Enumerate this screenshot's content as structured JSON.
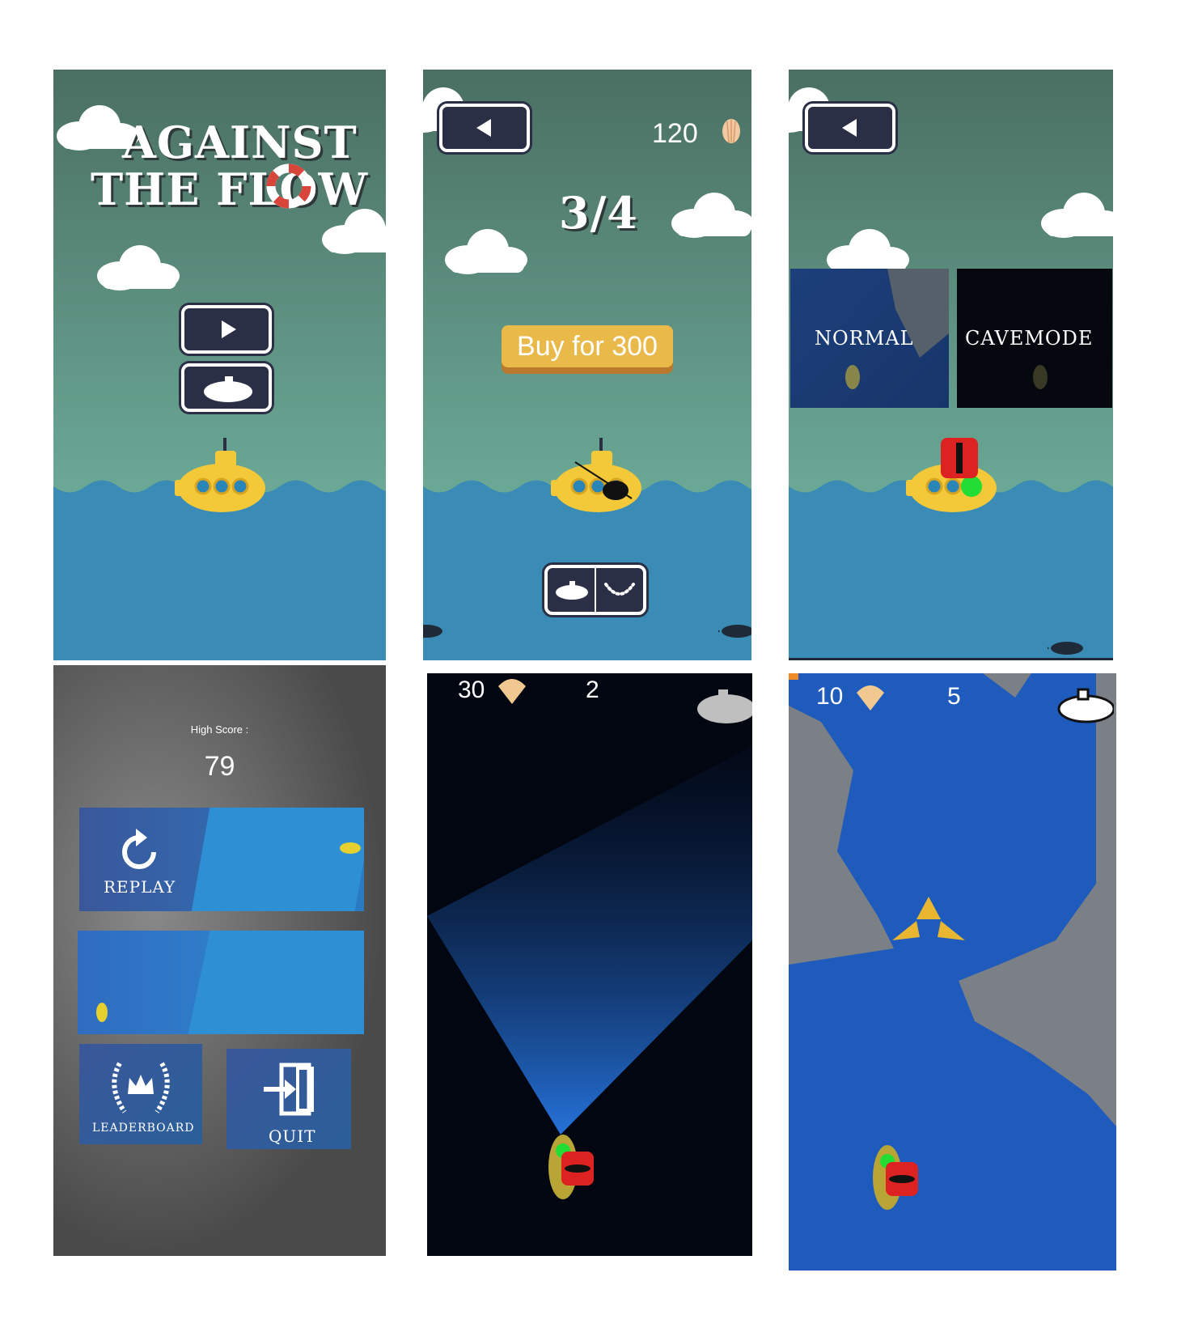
{
  "screen1": {
    "title_line1": "AGAINST",
    "title_line2": "THE FLOW",
    "play_label": "play",
    "sub_label": "submarine"
  },
  "screen2": {
    "coins": "120",
    "progress": "3/4",
    "buy_label": "Buy for 300"
  },
  "screen3": {
    "mode_normal": "NORMAL",
    "mode_cave": "CAVEMODE"
  },
  "screen4": {
    "high_score_label": "High Score :",
    "high_score_value": "79",
    "replay_label": "REPLAY",
    "leaderboard_label": "LEADERBOARD",
    "quit_label": "QUIT"
  },
  "screen5": {
    "shells": "30",
    "score": "2"
  },
  "screen6": {
    "shells": "10",
    "score": "5"
  },
  "colors": {
    "sea": "#3a8bb5",
    "button_dark": "#2b2f45",
    "sub_yellow": "#f3c93a",
    "buy_gold": "#e9b94a",
    "cave_blue": "#1f5bbd"
  }
}
